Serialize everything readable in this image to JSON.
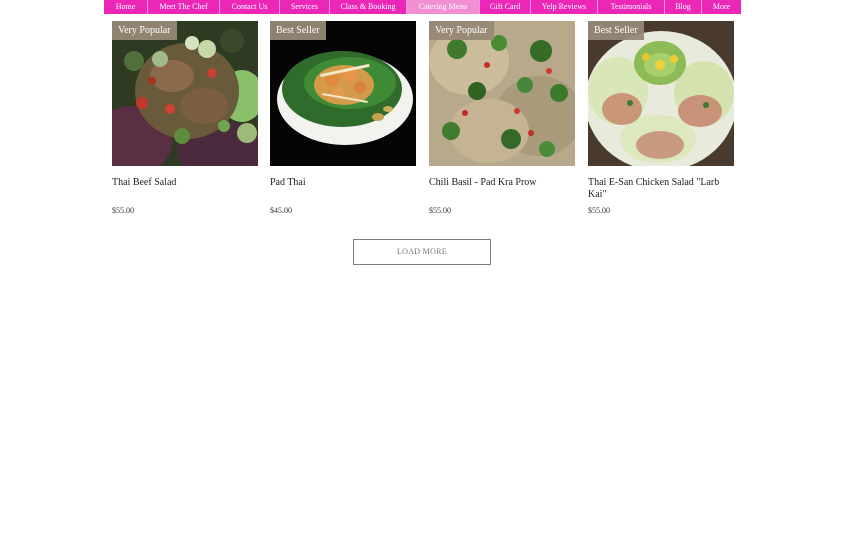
{
  "nav": {
    "items": [
      {
        "label": "Home"
      },
      {
        "label": "Meet The Chef"
      },
      {
        "label": "Contact Us"
      },
      {
        "label": "Services"
      },
      {
        "label": "Class & Booking"
      },
      {
        "label": "Catering Menu"
      },
      {
        "label": "Gift Card"
      },
      {
        "label": "Yelp Reviews"
      },
      {
        "label": "Testimonials"
      },
      {
        "label": "Blog"
      },
      {
        "label": "More"
      }
    ],
    "active": "Catering Menu",
    "color": "#ec27b8",
    "active_color": "#f28fd3"
  },
  "products": [
    {
      "ribbon": "Very Popular",
      "name": "Thai Beef Salad",
      "price": "$55.00"
    },
    {
      "ribbon": "Best Seller",
      "name": "Pad Thai",
      "price": "$45.00"
    },
    {
      "ribbon": "Very Popular",
      "name": "Chili Basil - Pad Kra Prow",
      "price": "$55.00"
    },
    {
      "ribbon": "Best Seller",
      "name": "Thai E-San Chicken Salad \"Larb Kai\"",
      "price": "$55.00"
    }
  ],
  "load_more": {
    "label": "LOAD MORE"
  }
}
